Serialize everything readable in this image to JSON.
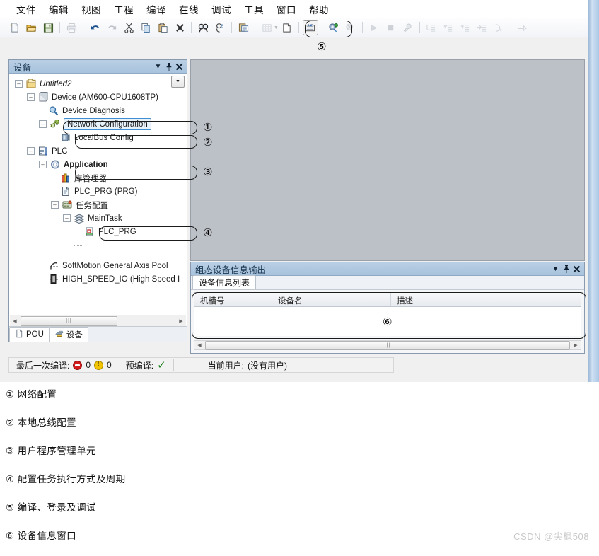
{
  "window": {
    "title": "AM600 PLC Programming IDE"
  },
  "menubar": {
    "items": [
      {
        "label": "文件"
      },
      {
        "label": "编辑"
      },
      {
        "label": "视图"
      },
      {
        "label": "工程"
      },
      {
        "label": "编译"
      },
      {
        "label": "在线"
      },
      {
        "label": "调试"
      },
      {
        "label": "工具"
      },
      {
        "label": "窗口"
      },
      {
        "label": "帮助"
      }
    ]
  },
  "toolbar": {
    "buttons": [
      {
        "icon": "new-file-icon",
        "enabled": true
      },
      {
        "icon": "open-folder-icon",
        "enabled": true
      },
      {
        "icon": "save-icon",
        "enabled": true
      },
      {
        "icon": "separator"
      },
      {
        "icon": "print-icon",
        "enabled": false
      },
      {
        "icon": "separator"
      },
      {
        "icon": "undo-icon",
        "enabled": true
      },
      {
        "icon": "redo-icon",
        "enabled": false
      },
      {
        "icon": "cut-icon",
        "enabled": true
      },
      {
        "icon": "copy-icon",
        "enabled": true
      },
      {
        "icon": "paste-icon",
        "enabled": true
      },
      {
        "icon": "delete-icon",
        "enabled": true
      },
      {
        "icon": "separator"
      },
      {
        "icon": "find-icon",
        "enabled": true
      },
      {
        "icon": "replace-icon",
        "enabled": true
      },
      {
        "icon": "separator"
      },
      {
        "icon": "properties-icon",
        "enabled": true
      },
      {
        "icon": "separator"
      },
      {
        "icon": "grid-icon",
        "enabled": false
      },
      {
        "icon": "dropdown-arrow-icon",
        "enabled": false
      },
      {
        "icon": "new-object-icon",
        "enabled": true
      },
      {
        "icon": "separator"
      },
      {
        "icon": "build-compile-icon",
        "enabled": true,
        "framed": true
      },
      {
        "icon": "separator"
      },
      {
        "icon": "login-icon",
        "enabled": true
      },
      {
        "icon": "logout-icon",
        "enabled": false
      },
      {
        "icon": "separator"
      },
      {
        "icon": "run-icon",
        "enabled": false
      },
      {
        "icon": "stop-icon",
        "enabled": false
      },
      {
        "icon": "debug-tools-icon",
        "enabled": false
      },
      {
        "icon": "separator"
      },
      {
        "icon": "step-over-icon",
        "enabled": false
      },
      {
        "icon": "step-into-icon",
        "enabled": false
      },
      {
        "icon": "step-out-icon",
        "enabled": false
      },
      {
        "icon": "run-to-cursor-icon",
        "enabled": false
      },
      {
        "icon": "set-next-statement-icon",
        "enabled": false
      },
      {
        "icon": "separator"
      },
      {
        "icon": "jump-icon",
        "enabled": false
      }
    ]
  },
  "device_panel": {
    "title": "设备",
    "header_icons": [
      "chevron-down-icon",
      "pin-icon",
      "close-icon"
    ],
    "tree": [
      {
        "label": "Untitled2",
        "icon": "project-icon",
        "indent": 0,
        "expander": "-",
        "style": "italic"
      },
      {
        "label": "Device (AM600-CPU1608TP)",
        "icon": "device-cpu-icon",
        "indent": 1,
        "expander": "-",
        "style": "normal"
      },
      {
        "label": "Device Diagnosis",
        "icon": "diagnosis-icon",
        "indent": 2,
        "expander": "",
        "style": "normal"
      },
      {
        "label": "Network Configuration",
        "icon": "network-config-icon",
        "indent": 2,
        "expander": "-",
        "style": "normal",
        "selected": true
      },
      {
        "label": "LocalBus Config",
        "icon": "localbus-icon",
        "indent": 3,
        "expander": "",
        "style": "normal"
      },
      {
        "label": "PLC",
        "icon": "plc-icon",
        "indent": 1,
        "expander": "-",
        "style": "normal"
      },
      {
        "label": "Application",
        "icon": "application-icon",
        "indent": 2,
        "expander": "-",
        "style": "bold"
      },
      {
        "label": "库管理器",
        "icon": "library-manager-icon",
        "indent": 3,
        "expander": "",
        "style": "normal"
      },
      {
        "label": "PLC_PRG (PRG)",
        "icon": "program-icon",
        "indent": 3,
        "expander": "",
        "style": "normal"
      },
      {
        "label": "任务配置",
        "icon": "task-config-icon",
        "indent": 3,
        "expander": "-",
        "style": "normal"
      },
      {
        "label": "MainTask",
        "icon": "task-icon",
        "indent": 4,
        "expander": "-",
        "style": "normal"
      },
      {
        "label": "PLC_PRG",
        "icon": "task-call-icon",
        "indent": 5,
        "expander": "",
        "style": "normal"
      },
      {
        "label": "SoftMotion General Axis Pool",
        "icon": "axis-pool-icon",
        "indent": 2,
        "expander": "",
        "style": "normal"
      },
      {
        "label": "HIGH_SPEED_IO (High Speed I",
        "icon": "high-speed-io-icon",
        "indent": 2,
        "expander": "",
        "style": "normal"
      }
    ],
    "tabs": [
      {
        "label": "POU",
        "icon": "pou-icon",
        "active": false
      },
      {
        "label": "设备",
        "icon": "device-icon",
        "active": true
      }
    ],
    "scrollbar_grip": "|||"
  },
  "output_panel": {
    "title": "组态设备信息输出",
    "header_icons": [
      "chevron-down-icon",
      "pin-icon",
      "close-icon"
    ],
    "tab": "设备信息列表",
    "columns": [
      "机槽号",
      "设备名",
      "描述"
    ],
    "rows": [],
    "scrollbar_grip": "|||"
  },
  "statusbar": {
    "last_build_label": "最后一次编译:",
    "error_count": "0",
    "warning_count": "0",
    "precompile_label": "预编译:",
    "precompile_status": "check-mark",
    "current_user_label": "当前用户:",
    "current_user_value": "(没有用户)"
  },
  "annotations": {
    "markers": [
      {
        "id": "1",
        "symbol": "①",
        "target": "Network Configuration"
      },
      {
        "id": "2",
        "symbol": "②",
        "target": "LocalBus Config"
      },
      {
        "id": "3",
        "symbol": "③",
        "target": "Application"
      },
      {
        "id": "4",
        "symbol": "④",
        "target": "MainTask"
      },
      {
        "id": "5",
        "symbol": "⑤",
        "target": "toolbar compile/login group"
      },
      {
        "id": "6",
        "symbol": "⑥",
        "target": "device info grid"
      }
    ]
  },
  "captions": [
    {
      "symbol": "①",
      "text": "网络配置"
    },
    {
      "symbol": "②",
      "text": "本地总线配置"
    },
    {
      "symbol": "③",
      "text": "用户程序管理单元"
    },
    {
      "symbol": "④",
      "text": "配置任务执行方式及周期"
    },
    {
      "symbol": "⑤",
      "text": "编译、登录及调试"
    },
    {
      "symbol": "⑥",
      "text": "设备信息窗口"
    }
  ],
  "watermark": "CSDN @尖枫508",
  "colors": {
    "panel_header": "#a8c3dd",
    "editor_bg": "#bcc0c7",
    "selection": "#e8f2fb",
    "selection_border": "#3f8fd0",
    "error": "#d31b1b",
    "warning": "#f2c400",
    "ok": "#167d16"
  }
}
